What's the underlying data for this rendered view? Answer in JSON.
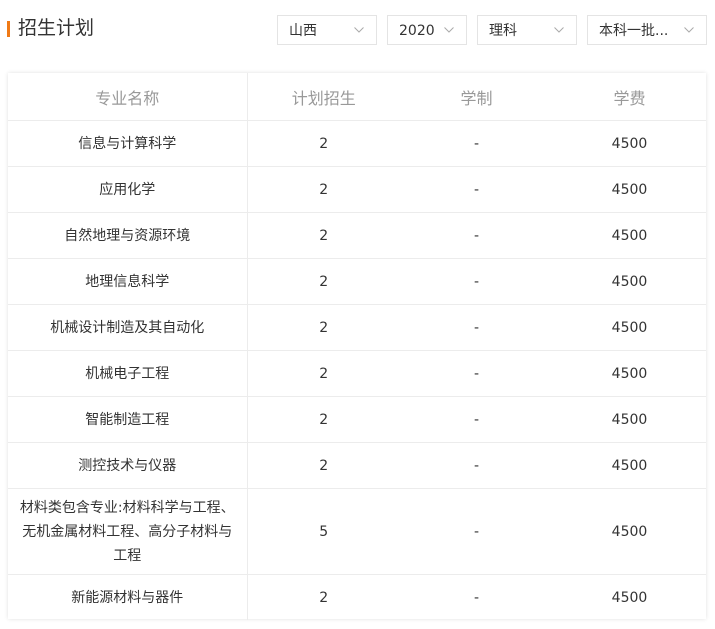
{
  "header": {
    "title": "招生计划"
  },
  "filters": {
    "province": "山西",
    "year": "2020",
    "subject": "理科",
    "batch": "本科一批..."
  },
  "table": {
    "headers": [
      "专业名称",
      "计划招生",
      "学制",
      "学费"
    ],
    "rows": [
      {
        "major": "信息与计算科学",
        "plan": "2",
        "duration": "-",
        "fee": "4500"
      },
      {
        "major": "应用化学",
        "plan": "2",
        "duration": "-",
        "fee": "4500"
      },
      {
        "major": "自然地理与资源环境",
        "plan": "2",
        "duration": "-",
        "fee": "4500"
      },
      {
        "major": "地理信息科学",
        "plan": "2",
        "duration": "-",
        "fee": "4500"
      },
      {
        "major": "机械设计制造及其自动化",
        "plan": "2",
        "duration": "-",
        "fee": "4500"
      },
      {
        "major": "机械电子工程",
        "plan": "2",
        "duration": "-",
        "fee": "4500"
      },
      {
        "major": "智能制造工程",
        "plan": "2",
        "duration": "-",
        "fee": "4500"
      },
      {
        "major": "测控技术与仪器",
        "plan": "2",
        "duration": "-",
        "fee": "4500"
      },
      {
        "major": "材料类包含专业:材料科学与工程、无机金属材料工程、高分子材料与工程",
        "plan": "5",
        "duration": "-",
        "fee": "4500"
      },
      {
        "major": "新能源材料与器件",
        "plan": "2",
        "duration": "-",
        "fee": "4500"
      }
    ]
  },
  "colors": {
    "accent": "#f07a16",
    "header_text": "#999999",
    "body_text": "#333333",
    "border": "#ececec"
  },
  "icons": {
    "dropdown": "chevron-down-icon"
  }
}
